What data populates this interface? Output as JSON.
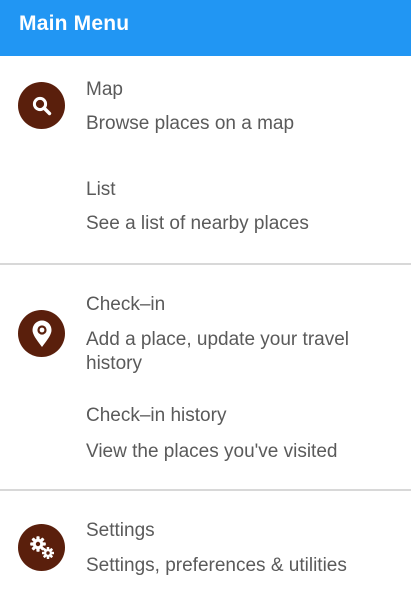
{
  "appbar": {
    "title": "Main Menu"
  },
  "sections": [
    {
      "icon": "search-icon",
      "items": [
        {
          "title": "Map",
          "subtitle": "Browse places on a map"
        },
        {
          "title": "List",
          "subtitle": "See a list of nearby places"
        }
      ]
    },
    {
      "icon": "location-pin-icon",
      "items": [
        {
          "title": "Check–in",
          "subtitle": "Add a place, update your travel history"
        },
        {
          "title": "Check–in history",
          "subtitle": "View the places you've visited"
        }
      ]
    },
    {
      "icon": "gears-icon",
      "items": [
        {
          "title": "Settings",
          "subtitle": "Settings, preferences & utilities"
        }
      ]
    }
  ],
  "colors": {
    "appbar": "#2196f3",
    "icon_circle": "#5a1f0c",
    "text": "#5a5a5a",
    "divider": "#d8d8d8"
  }
}
